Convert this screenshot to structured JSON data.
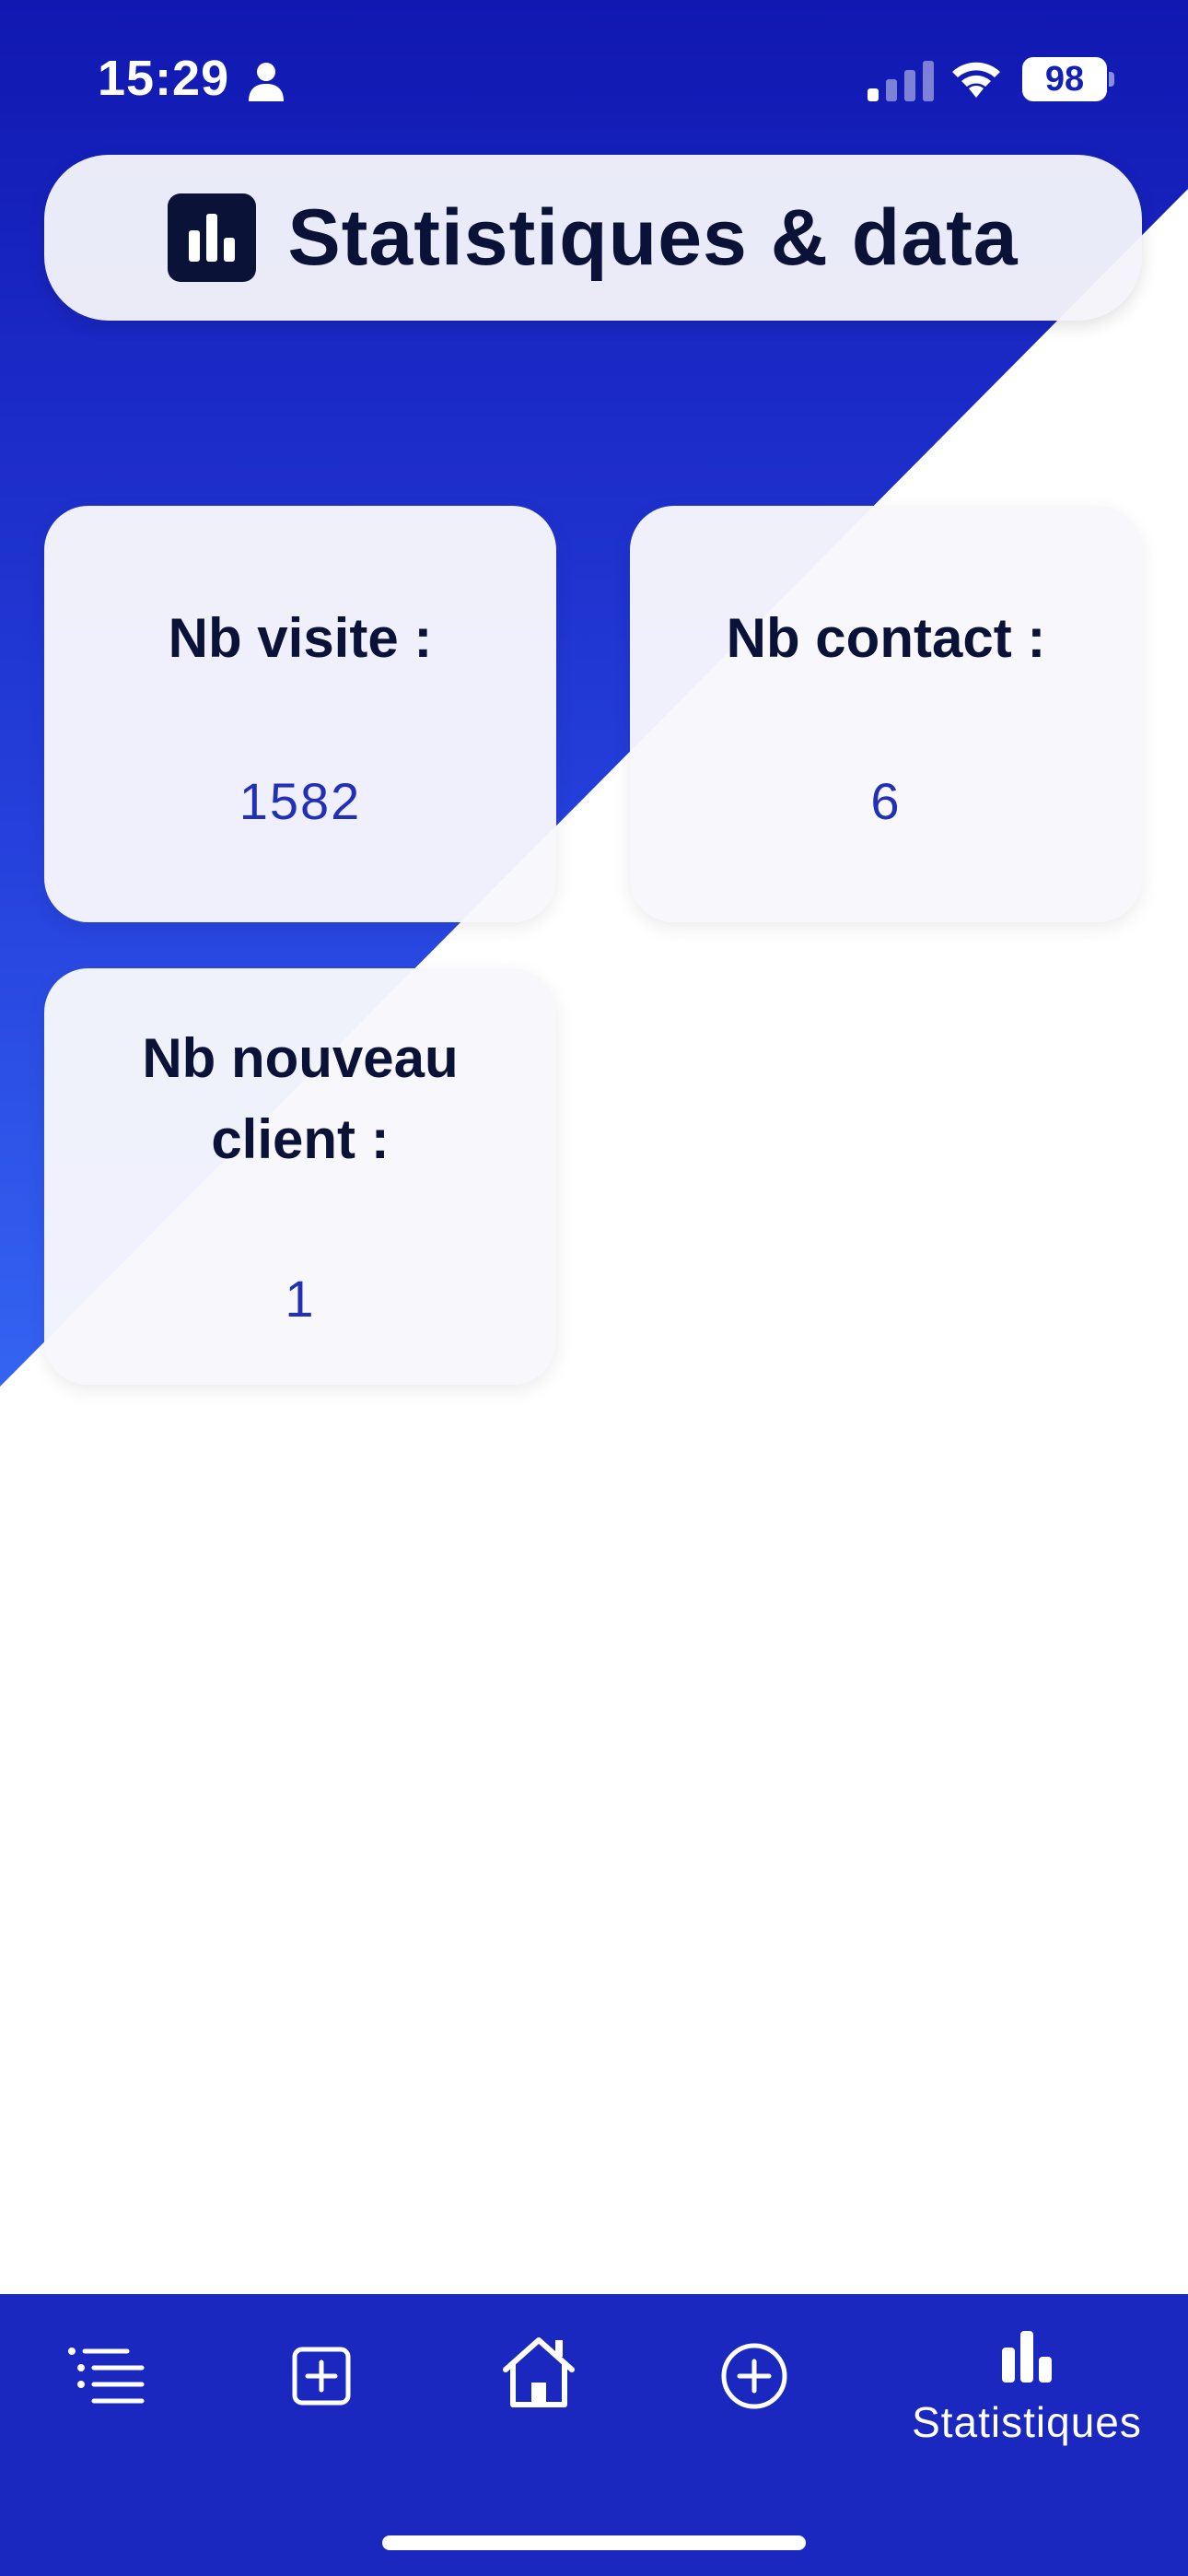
{
  "status_bar": {
    "time": "15:29",
    "battery": "98",
    "icons": [
      "person-icon",
      "signal-icon",
      "wifi-icon",
      "battery-icon"
    ]
  },
  "header": {
    "title": "Statistiques & data",
    "icon": "bar-chart-icon"
  },
  "cards": [
    {
      "label": "Nb visite :",
      "value": "1582"
    },
    {
      "label": "Nb contact :",
      "value": "6"
    },
    {
      "label": "Nb nouveau client :",
      "value": "1"
    }
  ],
  "bottom_nav": {
    "items": [
      {
        "icon": "list-icon",
        "label": ""
      },
      {
        "icon": "add-square-icon",
        "label": ""
      },
      {
        "icon": "home-icon",
        "label": ""
      },
      {
        "icon": "add-circle-icon",
        "label": ""
      },
      {
        "icon": "bar-chart-icon",
        "label": "Statistiques"
      }
    ],
    "active": "Statistiques"
  },
  "colors": {
    "primary_blue": "#1b28c0",
    "dark_navy": "#0b1238",
    "value_blue": "#2230b8",
    "card_bg": "#f8f8fc"
  }
}
